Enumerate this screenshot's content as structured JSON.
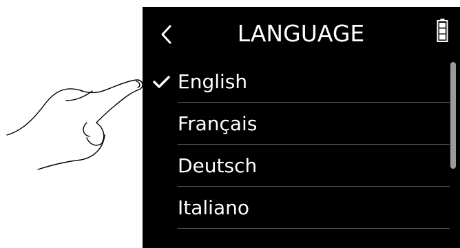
{
  "header": {
    "title": "LANGUAGE",
    "back_icon": "chevron-left-icon",
    "battery_icon": "battery-icon"
  },
  "languages": [
    {
      "label": "English",
      "selected": true
    },
    {
      "label": "Français",
      "selected": false
    },
    {
      "label": "Deutsch",
      "selected": false
    },
    {
      "label": "Italiano",
      "selected": false
    }
  ],
  "colors": {
    "screen_background": "#000000",
    "text": "#ffffff",
    "divider": "#5a5a5a",
    "scrollbar": "#9a9a9a"
  }
}
